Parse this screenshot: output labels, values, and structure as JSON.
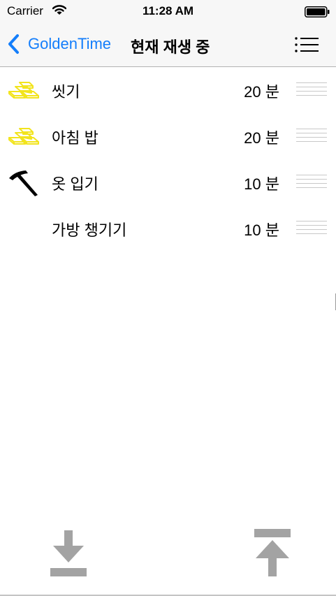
{
  "status_bar": {
    "carrier": "Carrier",
    "time": "11:28 AM"
  },
  "nav": {
    "back_label": "GoldenTime",
    "title": "현재 재생 중",
    "accent_color": "#147efb"
  },
  "tasks": [
    {
      "name": "씻기",
      "duration": "20 분",
      "icon": "gold-bars-icon"
    },
    {
      "name": "아침 밥",
      "duration": "20 분",
      "icon": "gold-bars-icon"
    },
    {
      "name": "옷 입기",
      "duration": "10 분",
      "icon": "pickaxe-icon"
    },
    {
      "name": "가방 챙기기",
      "duration": "10 분",
      "icon": ""
    }
  ],
  "toolbar": {
    "left_icon": "move-to-bottom-icon",
    "right_icon": "move-to-top-icon",
    "icon_color": "#a3a3a3"
  }
}
